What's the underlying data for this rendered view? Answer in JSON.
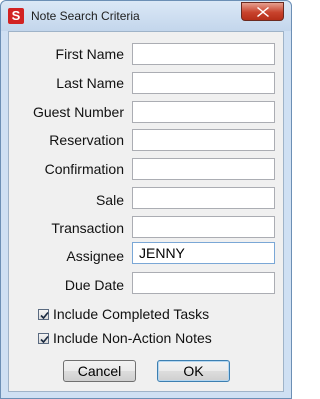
{
  "window": {
    "title": "Note Search Criteria",
    "app_icon_letter": "S"
  },
  "form": {
    "fields": [
      {
        "label": "First Name",
        "value": ""
      },
      {
        "label": "Last Name",
        "value": ""
      },
      {
        "label": "Guest Number",
        "value": ""
      },
      {
        "label": "Reservation",
        "value": ""
      },
      {
        "label": "Confirmation",
        "value": ""
      },
      {
        "label": "Sale",
        "value": ""
      },
      {
        "label": "Transaction",
        "value": ""
      },
      {
        "label": "Assignee",
        "value": "JENNY"
      },
      {
        "label": "Due Date",
        "value": ""
      }
    ],
    "checkboxes": [
      {
        "label": "Include Completed Tasks",
        "checked": true
      },
      {
        "label": "Include Non-Action Notes",
        "checked": true
      }
    ]
  },
  "buttons": {
    "cancel": "Cancel",
    "ok": "OK"
  }
}
